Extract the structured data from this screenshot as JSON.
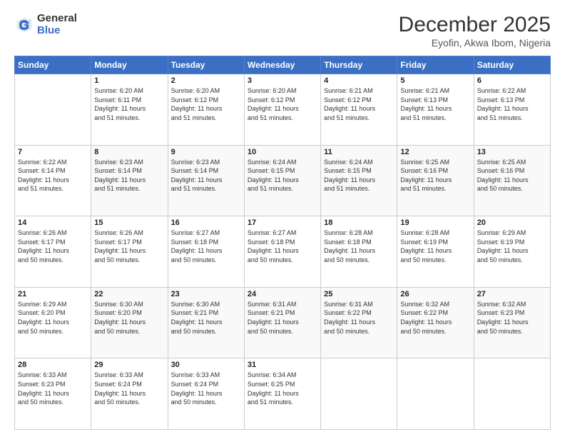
{
  "logo": {
    "general": "General",
    "blue": "Blue"
  },
  "header": {
    "month": "December 2025",
    "location": "Eyofin, Akwa Ibom, Nigeria"
  },
  "weekdays": [
    "Sunday",
    "Monday",
    "Tuesday",
    "Wednesday",
    "Thursday",
    "Friday",
    "Saturday"
  ],
  "weeks": [
    [
      {
        "day": "",
        "info": ""
      },
      {
        "day": "1",
        "info": "Sunrise: 6:20 AM\nSunset: 6:11 PM\nDaylight: 11 hours\nand 51 minutes."
      },
      {
        "day": "2",
        "info": "Sunrise: 6:20 AM\nSunset: 6:12 PM\nDaylight: 11 hours\nand 51 minutes."
      },
      {
        "day": "3",
        "info": "Sunrise: 6:20 AM\nSunset: 6:12 PM\nDaylight: 11 hours\nand 51 minutes."
      },
      {
        "day": "4",
        "info": "Sunrise: 6:21 AM\nSunset: 6:12 PM\nDaylight: 11 hours\nand 51 minutes."
      },
      {
        "day": "5",
        "info": "Sunrise: 6:21 AM\nSunset: 6:13 PM\nDaylight: 11 hours\nand 51 minutes."
      },
      {
        "day": "6",
        "info": "Sunrise: 6:22 AM\nSunset: 6:13 PM\nDaylight: 11 hours\nand 51 minutes."
      }
    ],
    [
      {
        "day": "7",
        "info": "Sunrise: 6:22 AM\nSunset: 6:14 PM\nDaylight: 11 hours\nand 51 minutes."
      },
      {
        "day": "8",
        "info": "Sunrise: 6:23 AM\nSunset: 6:14 PM\nDaylight: 11 hours\nand 51 minutes."
      },
      {
        "day": "9",
        "info": "Sunrise: 6:23 AM\nSunset: 6:14 PM\nDaylight: 11 hours\nand 51 minutes."
      },
      {
        "day": "10",
        "info": "Sunrise: 6:24 AM\nSunset: 6:15 PM\nDaylight: 11 hours\nand 51 minutes."
      },
      {
        "day": "11",
        "info": "Sunrise: 6:24 AM\nSunset: 6:15 PM\nDaylight: 11 hours\nand 51 minutes."
      },
      {
        "day": "12",
        "info": "Sunrise: 6:25 AM\nSunset: 6:16 PM\nDaylight: 11 hours\nand 51 minutes."
      },
      {
        "day": "13",
        "info": "Sunrise: 6:25 AM\nSunset: 6:16 PM\nDaylight: 11 hours\nand 50 minutes."
      }
    ],
    [
      {
        "day": "14",
        "info": "Sunrise: 6:26 AM\nSunset: 6:17 PM\nDaylight: 11 hours\nand 50 minutes."
      },
      {
        "day": "15",
        "info": "Sunrise: 6:26 AM\nSunset: 6:17 PM\nDaylight: 11 hours\nand 50 minutes."
      },
      {
        "day": "16",
        "info": "Sunrise: 6:27 AM\nSunset: 6:18 PM\nDaylight: 11 hours\nand 50 minutes."
      },
      {
        "day": "17",
        "info": "Sunrise: 6:27 AM\nSunset: 6:18 PM\nDaylight: 11 hours\nand 50 minutes."
      },
      {
        "day": "18",
        "info": "Sunrise: 6:28 AM\nSunset: 6:18 PM\nDaylight: 11 hours\nand 50 minutes."
      },
      {
        "day": "19",
        "info": "Sunrise: 6:28 AM\nSunset: 6:19 PM\nDaylight: 11 hours\nand 50 minutes."
      },
      {
        "day": "20",
        "info": "Sunrise: 6:29 AM\nSunset: 6:19 PM\nDaylight: 11 hours\nand 50 minutes."
      }
    ],
    [
      {
        "day": "21",
        "info": "Sunrise: 6:29 AM\nSunset: 6:20 PM\nDaylight: 11 hours\nand 50 minutes."
      },
      {
        "day": "22",
        "info": "Sunrise: 6:30 AM\nSunset: 6:20 PM\nDaylight: 11 hours\nand 50 minutes."
      },
      {
        "day": "23",
        "info": "Sunrise: 6:30 AM\nSunset: 6:21 PM\nDaylight: 11 hours\nand 50 minutes."
      },
      {
        "day": "24",
        "info": "Sunrise: 6:31 AM\nSunset: 6:21 PM\nDaylight: 11 hours\nand 50 minutes."
      },
      {
        "day": "25",
        "info": "Sunrise: 6:31 AM\nSunset: 6:22 PM\nDaylight: 11 hours\nand 50 minutes."
      },
      {
        "day": "26",
        "info": "Sunrise: 6:32 AM\nSunset: 6:22 PM\nDaylight: 11 hours\nand 50 minutes."
      },
      {
        "day": "27",
        "info": "Sunrise: 6:32 AM\nSunset: 6:23 PM\nDaylight: 11 hours\nand 50 minutes."
      }
    ],
    [
      {
        "day": "28",
        "info": "Sunrise: 6:33 AM\nSunset: 6:23 PM\nDaylight: 11 hours\nand 50 minutes."
      },
      {
        "day": "29",
        "info": "Sunrise: 6:33 AM\nSunset: 6:24 PM\nDaylight: 11 hours\nand 50 minutes."
      },
      {
        "day": "30",
        "info": "Sunrise: 6:33 AM\nSunset: 6:24 PM\nDaylight: 11 hours\nand 50 minutes."
      },
      {
        "day": "31",
        "info": "Sunrise: 6:34 AM\nSunset: 6:25 PM\nDaylight: 11 hours\nand 51 minutes."
      },
      {
        "day": "",
        "info": ""
      },
      {
        "day": "",
        "info": ""
      },
      {
        "day": "",
        "info": ""
      }
    ]
  ]
}
